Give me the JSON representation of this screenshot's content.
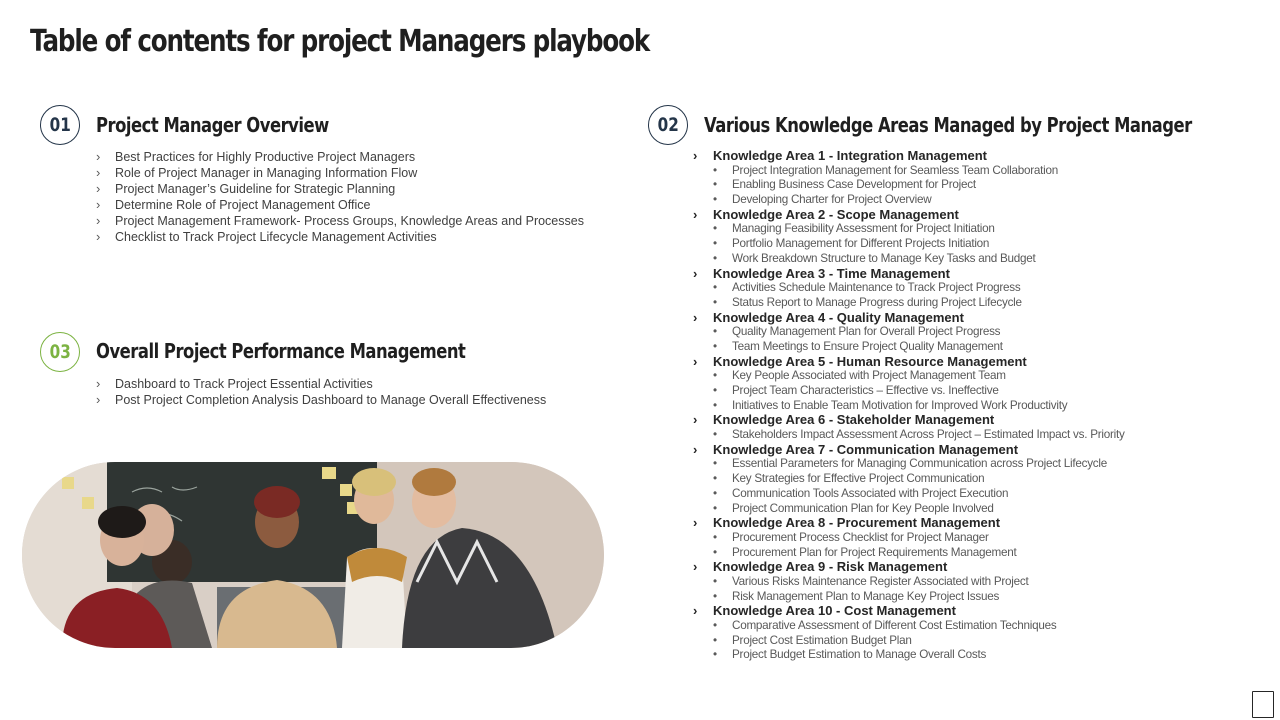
{
  "title": "Table of contents for project Managers playbook",
  "sections": [
    {
      "number": "01",
      "heading": "Project Manager Overview",
      "items": [
        "Best Practices for Highly Productive Project Managers",
        "Role of Project Manager in Managing Information Flow",
        "Project Manager’s Guideline for Strategic Planning",
        "Determine Role of Project Management Office",
        "Project Management Framework- Process Groups, Knowledge Areas and Processes",
        "Checklist to Track Project Lifecycle Management Activities"
      ]
    },
    {
      "number": "02",
      "heading": "Various Knowledge Areas Managed by Project Manager",
      "areas": [
        {
          "label": "Knowledge Area 1 - Integration Management",
          "items": [
            "Project Integration Management for Seamless Team Collaboration",
            "Enabling Business Case Development for Project",
            "Developing Charter for Project Overview"
          ]
        },
        {
          "label": "Knowledge Area 2 - Scope Management",
          "items": [
            "Managing Feasibility Assessment for Project Initiation",
            "Portfolio Management for Different Projects Initiation",
            "Work Breakdown Structure to Manage Key Tasks and Budget"
          ]
        },
        {
          "label": "Knowledge Area 3 - Time Management",
          "items": [
            "Activities Schedule Maintenance to Track Project Progress",
            "Status Report to Manage Progress during Project Lifecycle"
          ]
        },
        {
          "label": "Knowledge Area 4 - Quality Management",
          "items": [
            "Quality Management Plan for Overall Project Progress",
            "Team Meetings to Ensure Project Quality Management"
          ]
        },
        {
          "label": "Knowledge Area 5 - Human Resource Management",
          "items": [
            "Key People Associated with Project Management Team",
            "Project Team Characteristics – Effective vs. Ineffective",
            "Initiatives to Enable Team Motivation for Improved Work Productivity"
          ]
        },
        {
          "label": "Knowledge Area 6 - Stakeholder Management",
          "items": [
            "Stakeholders Impact Assessment Across Project – Estimated Impact vs. Priority"
          ]
        },
        {
          "label": "Knowledge Area 7 - Communication Management",
          "items": [
            "Essential Parameters for Managing Communication across Project Lifecycle",
            "Key Strategies for Effective Project Communication",
            "Communication Tools Associated with Project Execution",
            "Project Communication Plan for Key People Involved"
          ]
        },
        {
          "label": "Knowledge Area 8 - Procurement Management",
          "items": [
            "Procurement Process Checklist for Project Manager",
            "Procurement Plan for Project Requirements Management"
          ]
        },
        {
          "label": "Knowledge Area 9 - Risk Management",
          "items": [
            "Various Risks Maintenance Register Associated with Project",
            "Risk Management Plan to Manage Key Project Issues"
          ]
        },
        {
          "label": "Knowledge Area 10 - Cost Management",
          "items": [
            "Comparative Assessment of Different Cost Estimation Techniques",
            "Project Cost Estimation Budget Plan",
            "Project Budget Estimation to Manage Overall Costs"
          ]
        }
      ]
    },
    {
      "number": "03",
      "heading": "Overall Project Performance Management",
      "items": [
        "Dashboard to Track Project Essential Activities",
        "Post Project Completion Analysis Dashboard to Manage Overall Effectiveness"
      ]
    }
  ],
  "glyphs": {
    "chevron": "›",
    "bullet": "•"
  },
  "colors": {
    "badge_navy": "#243549",
    "badge_green": "#7cb342",
    "title": "#1f1f1f",
    "body_text": "#404040"
  },
  "icons": {
    "photo": "team-meeting-photo",
    "corner": "clipboard-icon"
  }
}
